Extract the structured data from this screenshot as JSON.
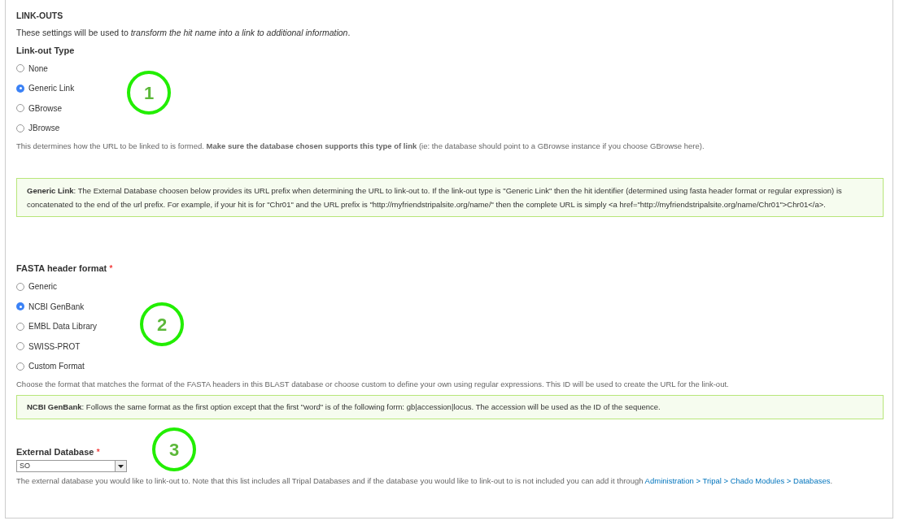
{
  "section": {
    "title": "LINK-OUTS",
    "description": {
      "text": "These settings will be used to",
      "emphasis": "transform the hit name into a link to additional information",
      "end": "."
    }
  },
  "link_out_type": {
    "label": "Link-out Type",
    "options": [
      {
        "label": "None",
        "selected": false
      },
      {
        "label": "Generic Link",
        "selected": true
      },
      {
        "label": "GBrowse",
        "selected": false
      },
      {
        "label": "JBrowse",
        "selected": false
      }
    ],
    "help": "This determines how the URL to be linked to is formed. **Make sure the database chosen supports this type of link** (ie: the database should point to a GBrowse instance if you choose GBrowse here).",
    "info": "**Generic Link**: The External Database choosen below provides its URL prefix when determining the URL to link-out to. If the link-out type is \"Generic Link\" then the hit identifier (determined using fasta header format or regular expression) is concatenated to the end of the url prefix. For example, if your hit is for \"Chr01\" and the URL prefix is \"http://myfriendstripalsite.org/name/\" then the complete URL is simply <a href=\"http://myfriendstripalsite.org/name/Chr01\">Chr01</a>."
  },
  "fasta_header_format": {
    "label": "FASTA header format",
    "required_marker": "*",
    "options": [
      {
        "label": "Generic",
        "selected": false
      },
      {
        "label": "NCBI GenBank",
        "selected": true
      },
      {
        "label": "EMBL Data Library",
        "selected": false
      },
      {
        "label": "SWISS-PROT",
        "selected": false
      },
      {
        "label": "Custom Format",
        "selected": false
      }
    ],
    "help": "Choose the format that matches the format of the FASTA headers in this BLAST database or choose custom to define your own using regular expressions. This ID will be used to create the URL for the link-out.",
    "info": "**NCBI GenBank**: Follows the same format as the first option except that the first \"word\" is of the following form: gb|accession|locus. The accession will be used as the ID of the sequence."
  },
  "external_database": {
    "label": "External Database",
    "required_marker": "*",
    "value": "SO",
    "help": "The external database you would like to link-out to. Note that this list includes all Tripal Databases and if the database you would like to link-out to is not included you can add it through",
    "link": "Administration > Tripal > Chado Modules > Databases",
    "help_end": "."
  },
  "annotations": [
    "1",
    "2",
    "3"
  ]
}
